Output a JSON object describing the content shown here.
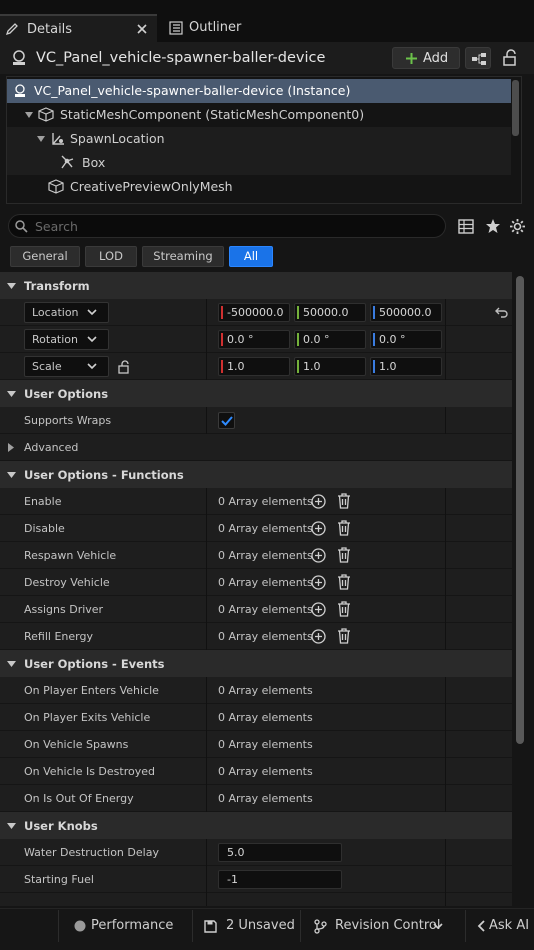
{
  "tabs": {
    "details_label": "Details",
    "outliner_label": "Outliner"
  },
  "header": {
    "title": "VC_Panel_vehicle-spawner-baller-device",
    "add_label": "Add"
  },
  "tree": {
    "items": [
      {
        "label": "VC_Panel_vehicle-spawner-baller-device (Instance)"
      },
      {
        "label": "StaticMeshComponent (StaticMeshComponent0)"
      },
      {
        "label": "SpawnLocation"
      },
      {
        "label": "Box"
      },
      {
        "label": "CreativePreviewOnlyMesh"
      }
    ]
  },
  "search": {
    "placeholder": "Search"
  },
  "filters": [
    "General",
    "LOD",
    "Streaming",
    "All"
  ],
  "transform": {
    "title": "Transform",
    "location_label": "Location",
    "rotation_label": "Rotation",
    "scale_label": "Scale",
    "location": [
      "-500000.0",
      "50000.0",
      "500000.0"
    ],
    "rotation": [
      "0.0 °",
      "0.0 °",
      "0.0 °"
    ],
    "scale": [
      "1.0",
      "1.0",
      "1.0"
    ]
  },
  "user_options": {
    "title": "User Options",
    "supports_wraps_label": "Supports Wraps",
    "supports_wraps": true,
    "advanced_label": "Advanced"
  },
  "functions": {
    "title": "User Options - Functions",
    "rows": [
      {
        "label": "Enable",
        "value": "0 Array elements"
      },
      {
        "label": "Disable",
        "value": "0 Array elements"
      },
      {
        "label": "Respawn Vehicle",
        "value": "0 Array elements"
      },
      {
        "label": "Destroy Vehicle",
        "value": "0 Array elements"
      },
      {
        "label": "Assigns Driver",
        "value": "0 Array elements"
      },
      {
        "label": "Refill Energy",
        "value": "0 Array elements"
      }
    ]
  },
  "events": {
    "title": "User Options - Events",
    "rows": [
      {
        "label": "On Player Enters Vehicle",
        "value": "0 Array elements"
      },
      {
        "label": "On Player Exits Vehicle",
        "value": "0 Array elements"
      },
      {
        "label": "On Vehicle Spawns",
        "value": "0 Array elements"
      },
      {
        "label": "On Vehicle Is Destroyed",
        "value": "0 Array elements"
      },
      {
        "label": "On Is Out Of Energy",
        "value": "0 Array elements"
      }
    ]
  },
  "knobs": {
    "title": "User Knobs",
    "rows": [
      {
        "label": "Water Destruction Delay",
        "value": "5.0"
      },
      {
        "label": "Starting Fuel",
        "value": "-1"
      }
    ]
  },
  "statusbar": {
    "performance": "Performance",
    "unsaved": "2 Unsaved",
    "revision": "Revision Control",
    "ask_ai": "Ask AI"
  },
  "colors": {
    "accent": "#1a73e8",
    "axis_x": "#d03030",
    "axis_y": "#74b13b",
    "axis_z": "#3a7ce0",
    "selection": "#4a5a70"
  }
}
